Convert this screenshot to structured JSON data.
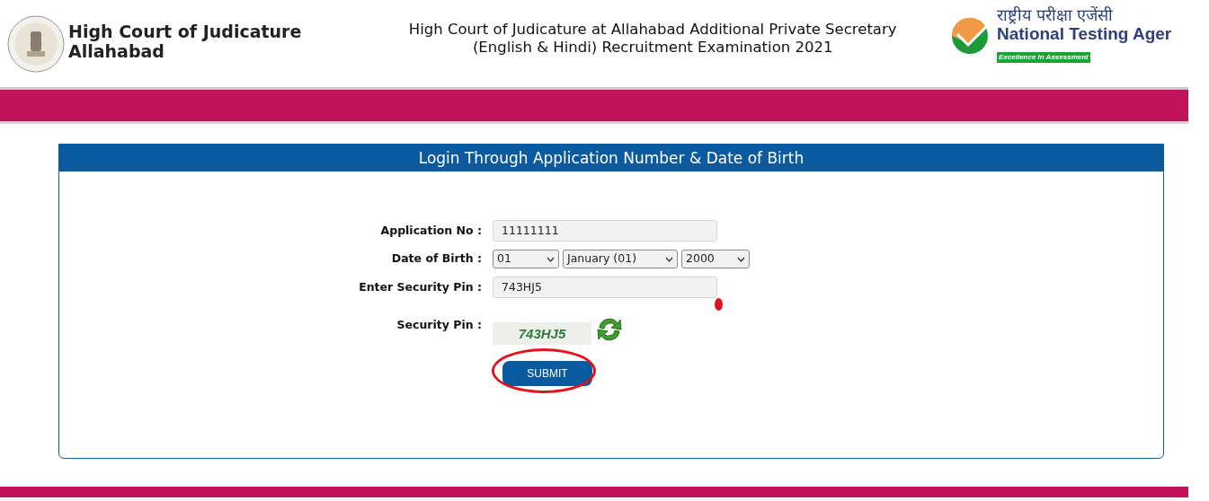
{
  "header": {
    "org_title": [
      "High Court of Judicature",
      "Allahabad"
    ],
    "exam_title": [
      "High Court of Judicature at Allahabad Additional Private Secretary",
      "(English & Hindi) Recruitment Examination 2021"
    ],
    "agency_logo": {
      "hindi": "राष्ट्रीय परीक्षा एजेंसी",
      "english": "National Testing Ager",
      "tagline": "Excellence in Assessment"
    }
  },
  "login_card": {
    "title": "Login Through Application Number & Date of Birth",
    "fields": [
      {
        "kind": "text",
        "label": "Application No :",
        "value": "11111111"
      },
      {
        "kind": "date",
        "label": "Date of Birth :",
        "selects": [
          "01",
          "January (01)",
          "2000"
        ]
      },
      {
        "kind": "text",
        "label": "Enter Security Pin :",
        "value": "743HJ5",
        "marked": true
      },
      {
        "kind": "captcha",
        "label": "Security Pin :",
        "captcha": "743HJ5"
      }
    ],
    "submit": {
      "label": "SUBMIT",
      "circled": true
    }
  }
}
